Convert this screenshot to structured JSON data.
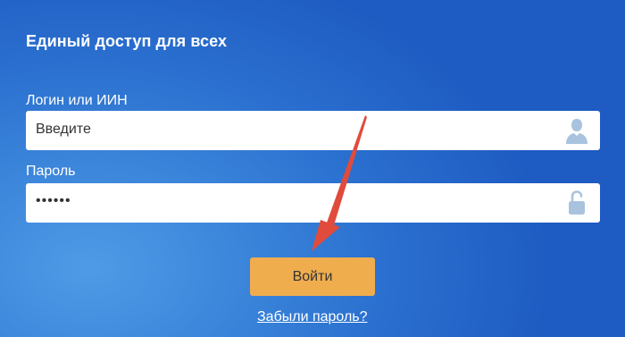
{
  "form": {
    "title": "Единый доступ для всех",
    "login_label": "Логин или ИИН",
    "login_placeholder": "Введите",
    "password_label": "Пароль",
    "password_value": "••••••",
    "submit_label": "Войти",
    "forgot_link": "Забыли пароль?"
  },
  "icons": {
    "login": "user-icon",
    "password": "unlock-icon"
  },
  "colors": {
    "background": "#2a6fcf",
    "submit_button": "#f0ad4e",
    "arrow": "#e04b3c",
    "icon": "#a9c3de"
  }
}
